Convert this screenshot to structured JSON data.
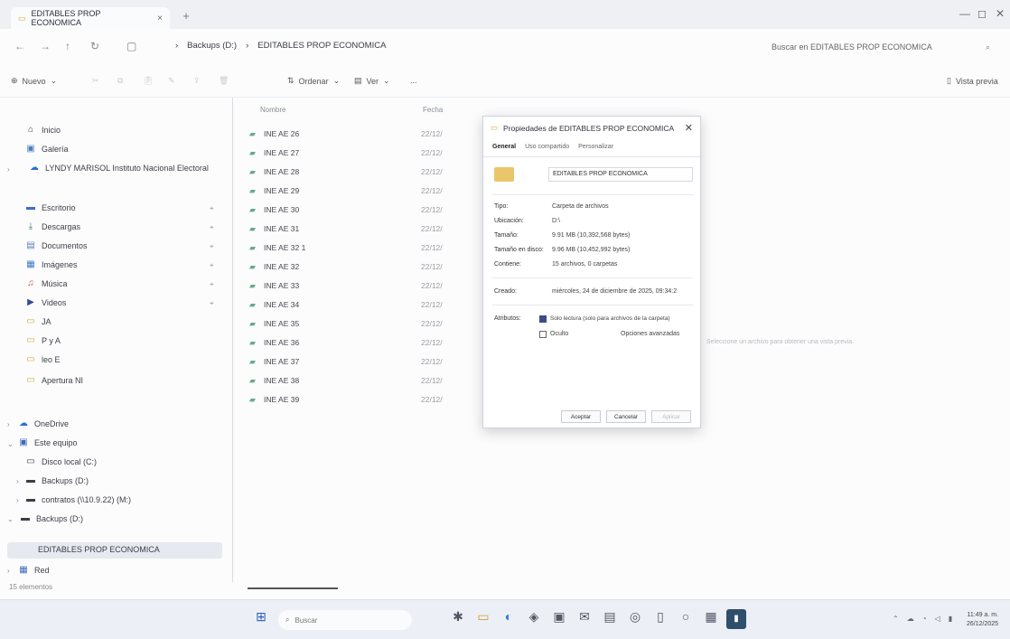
{
  "window": {
    "tab_title": "EDITABLES PROP ECONOMICA",
    "breadcrumbs": [
      "Backups (D:)",
      "EDITABLES PROP ECONOMICA"
    ],
    "search_placeholder": "Buscar en EDITABLES PROP ECONOMICA"
  },
  "commands": {
    "new": "Nuevo",
    "sort": "Ordenar",
    "view": "Ver",
    "more": "...",
    "preview": "Vista previa"
  },
  "sidebar": {
    "quick": [
      {
        "label": "Inicio",
        "icon": "home-icon"
      },
      {
        "label": "Galería",
        "icon": "gallery-icon"
      },
      {
        "label": "LYNDY MARISOL Instituto Nacional Electoral",
        "icon": "cloud-icon"
      }
    ],
    "pinned": [
      {
        "label": "Escritorio",
        "icon": "desktop-icon"
      },
      {
        "label": "Descargas",
        "icon": "download-icon"
      },
      {
        "label": "Documentos",
        "icon": "documents-icon"
      },
      {
        "label": "Imágenes",
        "icon": "pictures-icon"
      },
      {
        "label": "Música",
        "icon": "music-icon"
      },
      {
        "label": "Videos",
        "icon": "videos-icon"
      },
      {
        "label": "JA",
        "icon": "folder-icon"
      },
      {
        "label": "P y A",
        "icon": "folder-icon"
      },
      {
        "label": "leo E",
        "icon": "folder-icon"
      },
      {
        "label": "Apertura NI",
        "icon": "folder-icon"
      }
    ],
    "tree": [
      {
        "label": "OneDrive",
        "icon": "onedrive-icon"
      },
      {
        "label": "Este equipo",
        "icon": "pc-icon"
      },
      {
        "label": "Disco local (C:)",
        "icon": "drive-icon"
      },
      {
        "label": "Backups (D:)",
        "icon": "drive-icon"
      },
      {
        "label": "contratos (\\\\10.9.22) (M:)",
        "icon": "network-drive-icon"
      },
      {
        "label": "Backups (D:)",
        "icon": "drive-icon"
      },
      {
        "label": "EDITABLES PROP ECONOMICA",
        "icon": "folder-icon"
      },
      {
        "label": "Red",
        "icon": "network-icon"
      }
    ]
  },
  "filelist": {
    "col_name": "Nombre",
    "col_date": "Fecha",
    "files": [
      {
        "name": "INE AE 26",
        "date": "22/12/"
      },
      {
        "name": "INE AE 27",
        "date": "22/12/"
      },
      {
        "name": "INE AE 28",
        "date": "22/12/"
      },
      {
        "name": "INE AE 29",
        "date": "22/12/"
      },
      {
        "name": "INE AE 30",
        "date": "22/12/"
      },
      {
        "name": "INE AE 31",
        "date": "22/12/"
      },
      {
        "name": "INE AE 32 1",
        "date": "22/12/"
      },
      {
        "name": "INE AE 32",
        "date": "22/12/"
      },
      {
        "name": "INE AE 33",
        "date": "22/12/"
      },
      {
        "name": "INE AE 34",
        "date": "22/12/"
      },
      {
        "name": "INE AE 35",
        "date": "22/12/"
      },
      {
        "name": "INE AE 36",
        "date": "22/12/"
      },
      {
        "name": "INE AE 37",
        "date": "22/12/"
      },
      {
        "name": "INE AE 38",
        "date": "22/12/"
      },
      {
        "name": "INE AE 39",
        "date": "22/12/"
      }
    ],
    "status": "15 elementos",
    "hint": "Seleccione un archivo para obtener una vista previa."
  },
  "dialog": {
    "title": "Propiedades de EDITABLES PROP ECONOMICA",
    "tabs": [
      "General",
      "Uso compartido",
      "Personalizar"
    ],
    "folder_name": "EDITABLES PROP ECONOMICA",
    "props": [
      {
        "label": "Tipo:",
        "value": "Carpeta de archivos"
      },
      {
        "label": "Ubicación:",
        "value": "D:\\"
      },
      {
        "label": "Tamaño:",
        "value": "9.91 MB (10,392,568 bytes)"
      },
      {
        "label": "Tamaño en disco:",
        "value": "9.96 MB (10,452,992 bytes)"
      },
      {
        "label": "Contiene:",
        "value": "15 archivos, 0 carpetas"
      }
    ],
    "created_label": "Creado:",
    "created_value": "miércoles, 24 de diciembre de 2025, 09:34:2",
    "attributes_label": "Atributos:",
    "readonly_label": "Solo lectura (solo para archivos de la carpeta)",
    "hidden_label": "Oculto",
    "advanced_label": "Opciones avanzadas",
    "ok": "Aceptar",
    "cancel": "Cancelar",
    "apply": "Aplicar"
  },
  "taskbar": {
    "search": "Buscar",
    "time": "11:49 a. m.",
    "date": "26/12/2025"
  }
}
